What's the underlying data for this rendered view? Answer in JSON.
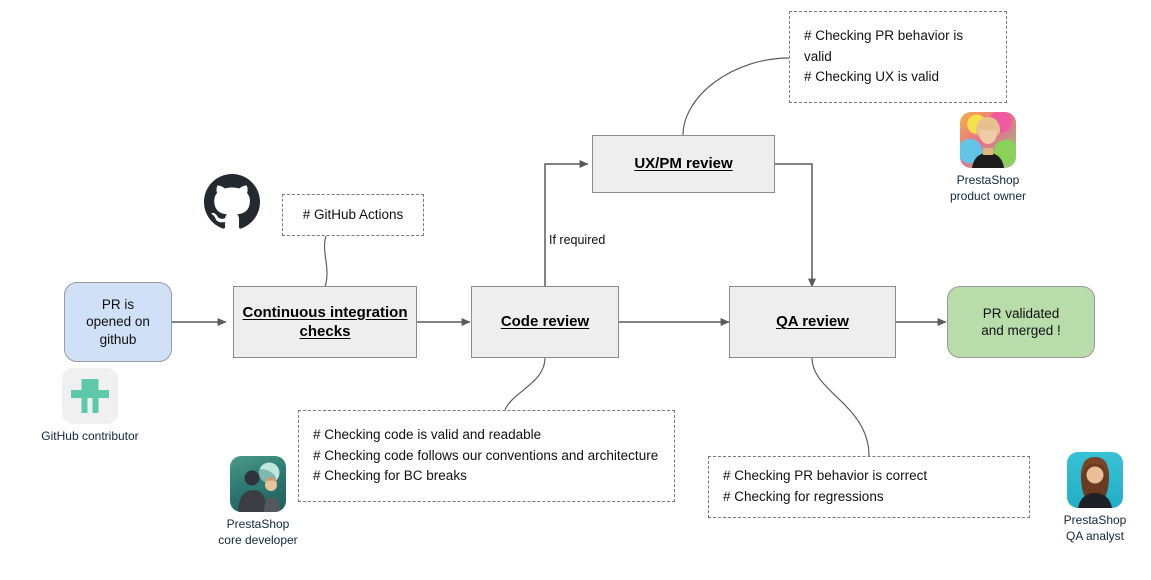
{
  "diagram": {
    "title": "PrestaShop pull request review workflow",
    "colors": {
      "process_fill": "#eeeeee",
      "process_stroke": "#8c8c8c",
      "start_fill": "#cfe0f7",
      "end_fill": "#b9ddaa",
      "connector": "#606060",
      "note_stroke": "#7a7a7a",
      "caption_text": "#12263f"
    }
  },
  "nodes": {
    "start": {
      "label": "PR is\nopened on\ngithub",
      "shape": "rounded",
      "fill": "#cfe0f7"
    },
    "ci": {
      "label": "Continuous integration\nchecks",
      "shape": "rect",
      "fill": "#eeeeee"
    },
    "code_review": {
      "label": "Code review",
      "shape": "rect",
      "fill": "#eeeeee"
    },
    "uxpm_review": {
      "label": "UX/PM review",
      "shape": "rect",
      "fill": "#eeeeee"
    },
    "qa_review": {
      "label": "QA review",
      "shape": "rect",
      "fill": "#eeeeee"
    },
    "end": {
      "label": "PR validated\nand merged !",
      "shape": "rounded",
      "fill": "#b9ddaa"
    }
  },
  "edges": {
    "if_required_label": "If required"
  },
  "notes": {
    "github_actions": "# GitHub Actions",
    "uxpm": "# Checking PR behavior is valid\n# Checking UX is valid",
    "code_review": "# Checking code is valid and readable\n# Checking code follows our conventions and architecture\n# Checking for BC breaks",
    "qa": "# Checking PR behavior is correct\n# Checking for regressions"
  },
  "personas": {
    "contributor": {
      "caption": "GitHub contributor",
      "avatar": "github-mark-tile"
    },
    "product_owner": {
      "caption": "PrestaShop\nproduct owner",
      "avatar": "photo-woman-colorful"
    },
    "core_developer": {
      "caption": "PrestaShop\ncore developer",
      "avatar": "photo-adult-child-aquarium"
    },
    "qa_analyst": {
      "caption": "PrestaShop\nQA analyst",
      "avatar": "photo-woman-teal"
    }
  },
  "icons": {
    "github_logo": "github-octocat-icon"
  }
}
